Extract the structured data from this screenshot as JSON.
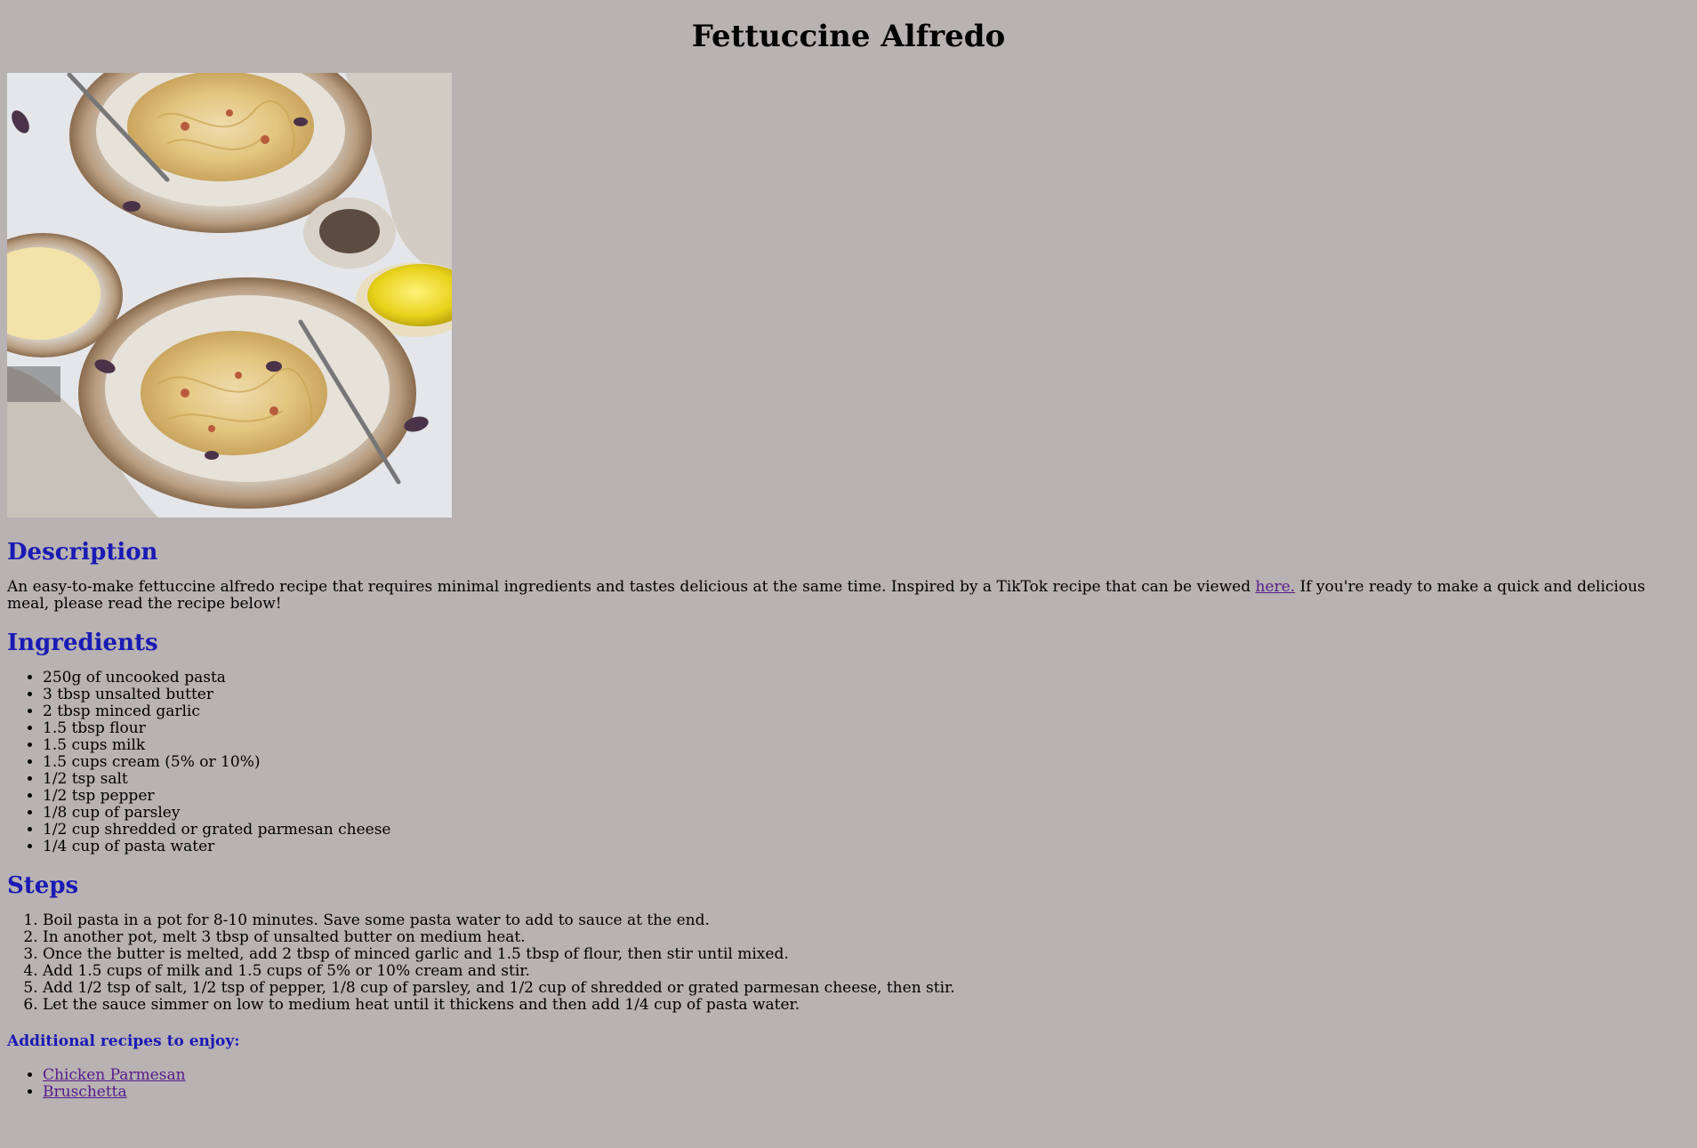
{
  "page": {
    "title": "Fettuccine Alfredo"
  },
  "hero_image": {
    "alt": "Fettuccine Alfredo"
  },
  "description": {
    "heading": "Description",
    "text_before_link": "An easy-to-make fettuccine alfredo recipe that requires minimal ingredients and tastes delicious at the same time. Inspired by a TikTok recipe that can be viewed ",
    "link_label": "here.",
    "text_after_link": " If you're ready to make a quick and delicious meal, please read the recipe below!"
  },
  "ingredients": {
    "heading": "Ingredients",
    "items": [
      "250g of uncooked pasta",
      "3 tbsp unsalted butter",
      "2 tbsp minced garlic",
      "1.5 tbsp flour",
      "1.5 cups milk",
      "1.5 cups cream (5% or 10%)",
      "1/2 tsp salt",
      "1/2 tsp pepper",
      "1/8 cup of parsley",
      "1/2 cup shredded or grated parmesan cheese",
      "1/4 cup of pasta water"
    ]
  },
  "steps": {
    "heading": "Steps",
    "items": [
      "Boil pasta in a pot for 8-10 minutes. Save some pasta water to add to sauce at the end.",
      "In another pot, melt 3 tbsp of unsalted butter on medium heat.",
      "Once the butter is melted, add 2 tbsp of minced garlic and 1.5 tbsp of flour, then stir until mixed.",
      "Add 1.5 cups of milk and 1.5 cups of 5% or 10% cream and stir.",
      "Add 1/2 tsp of salt, 1/2 tsp of pepper, 1/8 cup of parsley, and 1/2 cup of shredded or grated parmesan cheese, then stir.",
      "Let the sauce simmer on low to medium heat until it thickens and then add 1/4 cup of pasta water."
    ]
  },
  "additional": {
    "heading": "Additional recipes to enjoy:",
    "links": [
      "Chicken Parmesan",
      "Bruschetta"
    ]
  },
  "colors": {
    "background": "#b8b2b2",
    "heading_blue": "#1a1ab4",
    "link_visited": "#551a8b"
  }
}
